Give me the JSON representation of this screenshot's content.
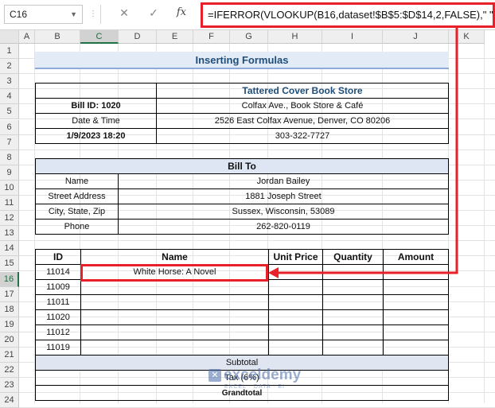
{
  "formula_bar": {
    "name_box": "C16",
    "cancel_icon": "✕",
    "enter_icon": "✓",
    "fx_label": "fx",
    "formula": "=IFERROR(VLOOKUP(B16,dataset!$B$5:$D$14,2,FALSE),\" \")"
  },
  "columns": [
    "A",
    "B",
    "C",
    "D",
    "E",
    "F",
    "G",
    "H",
    "I",
    "J",
    "K"
  ],
  "rows": [
    "1",
    "2",
    "3",
    "4",
    "5",
    "6",
    "7",
    "8",
    "9",
    "10",
    "11",
    "12",
    "13",
    "14",
    "15",
    "16",
    "17",
    "18",
    "19",
    "20",
    "21",
    "22",
    "23",
    "24"
  ],
  "selected_col": "C",
  "selected_row": "16",
  "sheet": {
    "title": "Inserting Formulas",
    "store_name": "Tattered Cover Book Store",
    "bill_id": "Bill ID: 1020",
    "store_addr1": "Colfax Ave., Book Store & Café",
    "date_time_label": "Date & Time",
    "store_addr2": "2526 East Colfax Avenue, Denver, CO 80206",
    "date_time_value": "1/9/2023 18:20",
    "store_phone": "303-322-7727",
    "bill_to": "Bill To",
    "name_label": "Name",
    "name_value": "Jordan Bailey",
    "street_label": "Street Address",
    "street_value": "1881 Joseph Street",
    "city_label": "City, State, Zip",
    "city_value": "Sussex, Wisconsin, 53089",
    "phone_label": "Phone",
    "phone_value": "262-820-0119",
    "headers": {
      "id": "ID",
      "name": "Name",
      "unit_price": "Unit Price",
      "quantity": "Quantity",
      "amount": "Amount"
    },
    "items": [
      {
        "id": "11014",
        "name": "White Horse: A Novel"
      },
      {
        "id": "11009",
        "name": ""
      },
      {
        "id": "11011",
        "name": ""
      },
      {
        "id": "11020",
        "name": ""
      },
      {
        "id": "11012",
        "name": ""
      },
      {
        "id": "11019",
        "name": ""
      }
    ],
    "subtotal": "Subtotal",
    "tax": "Tax (6%)",
    "grandtotal": "Grandtotal"
  },
  "watermark": {
    "brand": "exceldemy",
    "tagline": "EXCEL · DATA · BI"
  },
  "colors": {
    "accent_red": "#e8202a",
    "excel_green": "#217346",
    "header_blue": "#1f4e79"
  }
}
